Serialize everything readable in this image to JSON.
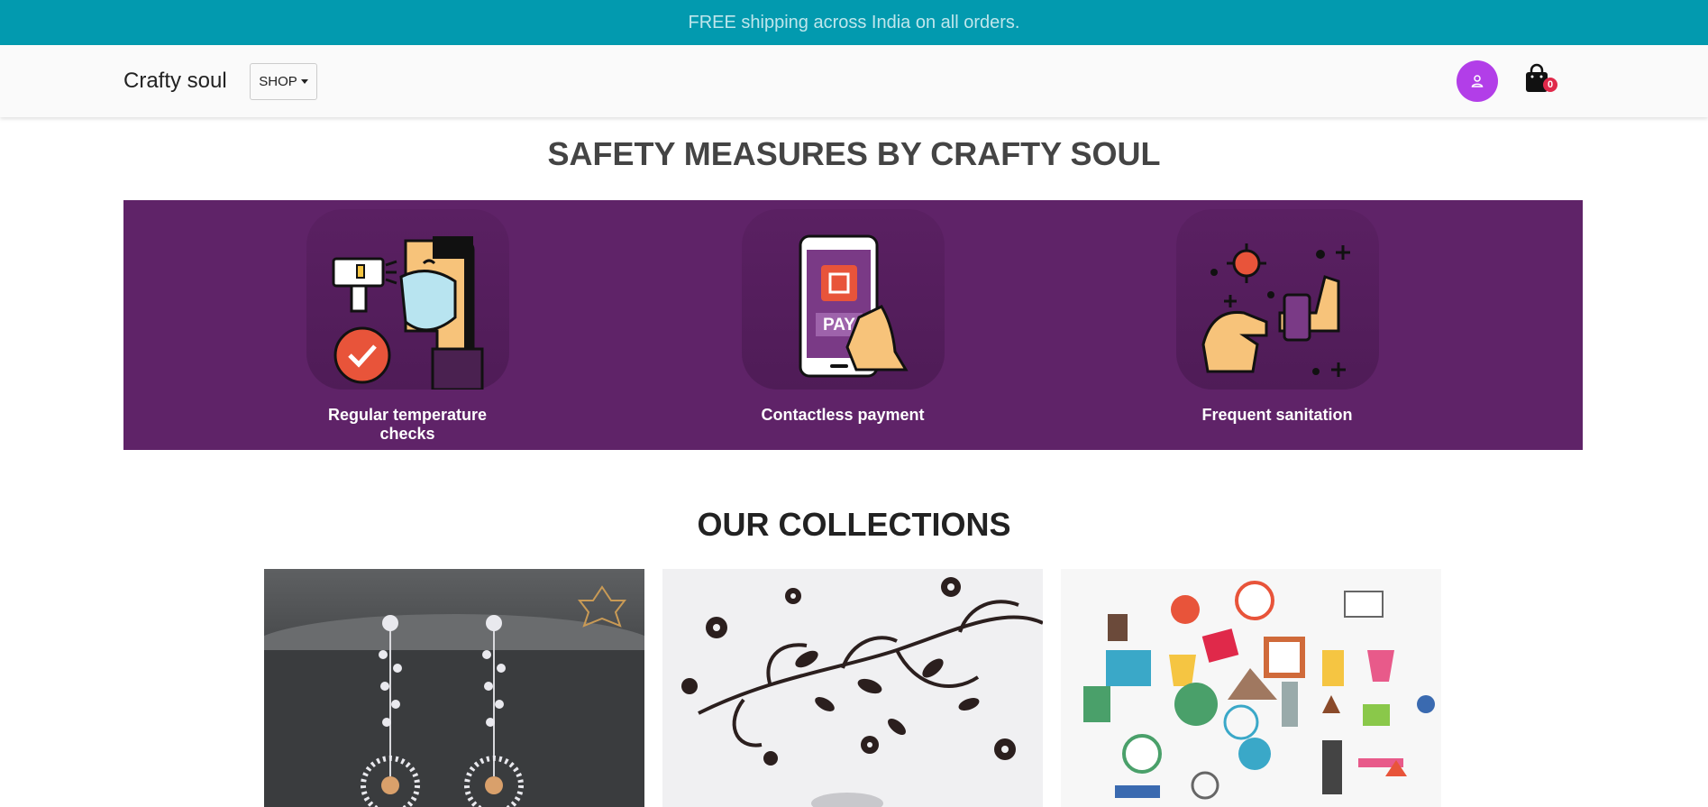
{
  "announcement": "FREE shipping across India on all orders.",
  "navbar": {
    "brand": "Crafty soul",
    "shop_label": "SHOP",
    "cart_count": "0",
    "user_icon": "user-icon",
    "cart_icon": "shopping-bag-icon"
  },
  "safety": {
    "title": "SAFETY MEASURES BY CRAFTY SOUL",
    "items": [
      {
        "label": "Regular temperature checks",
        "icon": "temperature-check-icon"
      },
      {
        "label": "Contactless payment",
        "icon": "contactless-payment-icon"
      },
      {
        "label": "Frequent sanitation",
        "icon": "sanitation-icon"
      }
    ],
    "pay_text": "PAY"
  },
  "collections": {
    "title": "OUR COLLECTIONS",
    "items": [
      {
        "image": "earrings-image"
      },
      {
        "image": "floral-wall-decal-image"
      },
      {
        "image": "home-decor-items-image"
      }
    ]
  },
  "colors": {
    "topbar": "#029aaf",
    "banner": "#5f2368",
    "avatar": "#b23ee8",
    "badge": "#e0294a"
  }
}
